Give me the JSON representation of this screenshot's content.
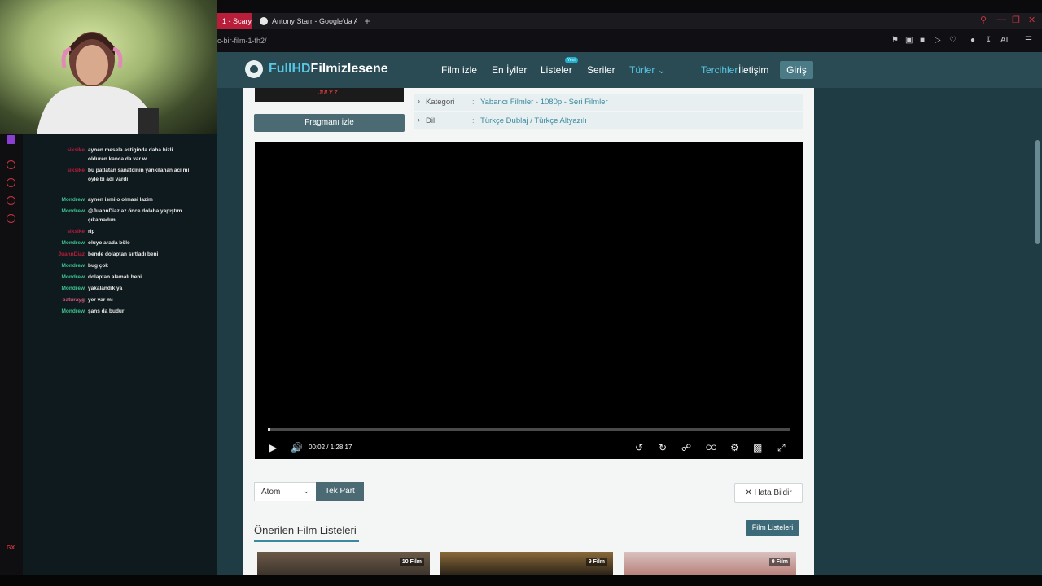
{
  "browser": {
    "tabs": [
      {
        "label": "1 - Scary"
      },
      {
        "label": "Antony Starr - Google'da A"
      }
    ],
    "new_tab": "+",
    "url": "c-bir-film-1-fh2/",
    "ai_label": "AI"
  },
  "chat": {
    "messages": [
      {
        "user": "siksike",
        "text": "aynen mesela astiginda daha hizli olduren kanca da var w",
        "color": "#b81d3a"
      },
      {
        "user": "siksike",
        "text": "bu patlatan sanatcinin yankilanan aci mi oyle bi adi vardi",
        "color": "#b81d3a"
      },
      {
        "user": "Mondrew",
        "text": "aynen ismi o olmasi lazim",
        "color": "#3cc48f"
      },
      {
        "user": "Mondrew",
        "text": "@JuannDiaz az önce dolaba yapıştım çıkamadım",
        "color": "#3cc48f"
      },
      {
        "user": "siksike",
        "text": "rip",
        "color": "#b81d3a"
      },
      {
        "user": "Mondrew",
        "text": "oluyo arada böle",
        "color": "#3cc48f"
      },
      {
        "user": "JuannDiaz",
        "text": "bende dolaptan sırtladı beni",
        "color": "#b81d3a"
      },
      {
        "user": "Mondrew",
        "text": "bug çok",
        "color": "#3cc48f"
      },
      {
        "user": "Mondrew",
        "text": "dolaptan alamalı beni",
        "color": "#3cc48f"
      },
      {
        "user": "Mondrew",
        "text": "yakalandık ya",
        "color": "#3cc48f"
      },
      {
        "user": "baturayg",
        "text": "yer var mı",
        "color": "#d05a7a"
      },
      {
        "user": "Mondrew",
        "text": "şans da budur",
        "color": "#3cc48f"
      }
    ],
    "gx_label": "GX"
  },
  "site": {
    "logo_bold": "FullHD",
    "logo_rest": "Filmizlesene",
    "nav": [
      "Film izle",
      "En İyiler",
      "Listeler",
      "Seriler",
      "Türler",
      "Tercihler",
      "İletişim"
    ],
    "new_badge": "Yeni",
    "login": "Giriş",
    "poster_text": "JULY 7",
    "trailer_button": "Fragmanı izle",
    "info": [
      {
        "key": "Kategori",
        "value": "Yabancı Filmler - 1080p - Seri Filmler"
      },
      {
        "key": "Dil",
        "value": "Türkçe Dublaj / Türkçe Altyazılı"
      }
    ],
    "info_sep": ":",
    "player": {
      "current": "00:02",
      "separator": "/",
      "duration": "1:28:17",
      "progress_fraction": 0.004
    },
    "source_select": "Atom",
    "single_part": "Tek Part",
    "report_button": "Hata Bildir",
    "lists_title": "Önerilen Film Listeleri",
    "lists_button": "Film Listeleri",
    "cards": [
      {
        "count": "10 Film"
      },
      {
        "count": "9 Film"
      },
      {
        "count": "9 Film"
      }
    ]
  },
  "colors": {
    "accent": "#57c7e5",
    "brand_dark": "#2a4a54",
    "browser_red": "#c8343f"
  }
}
